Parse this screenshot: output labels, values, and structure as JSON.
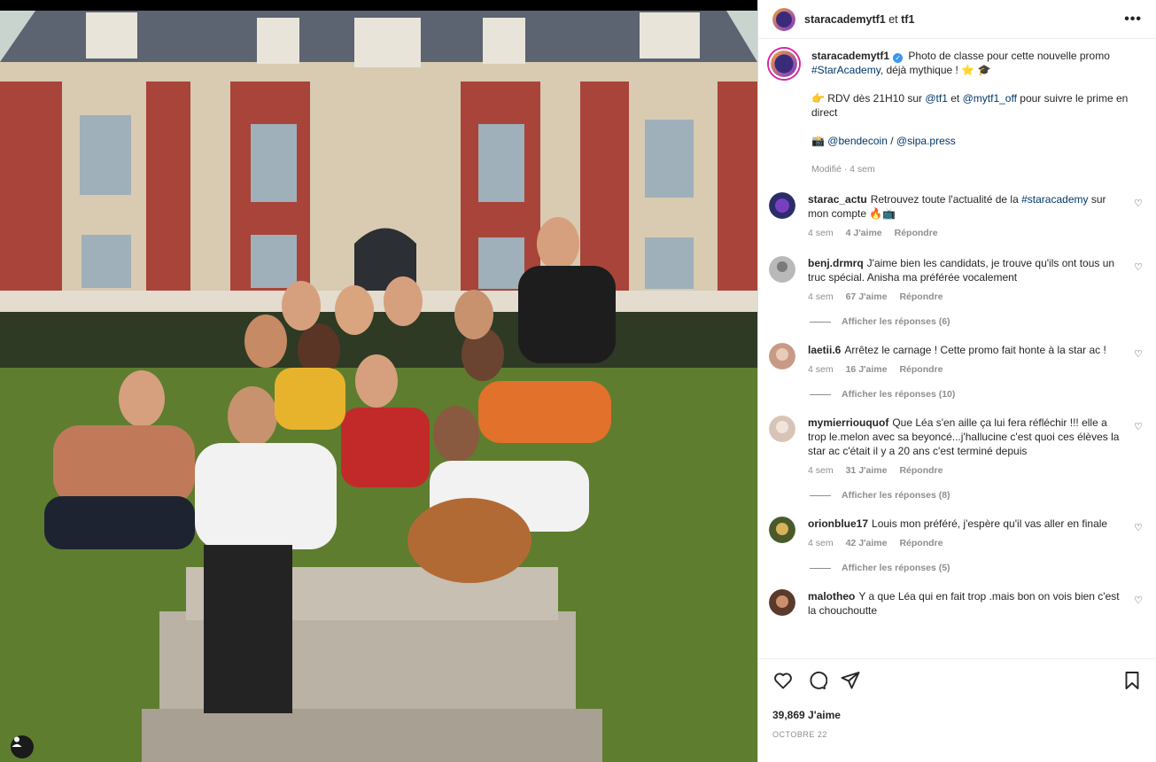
{
  "post": {
    "author": "staracademytf1",
    "coauthor_sep": "et",
    "coauthor": "tf1",
    "more_icon": "more-horizontal-icon"
  },
  "caption": {
    "username": "staracademytf1",
    "text_1a": "Photo de classe pour cette nouvelle promo",
    "hashtag": "#StarAcademy",
    "text_1b": ", déjà mythique ! ⭐ 🎓",
    "rdv_emoji": "👉",
    "rdv_a": "RDV dès 21H10 sur",
    "mention_tf1": "@tf1",
    "rdv_et": "et",
    "mention_mytf1": "@mytf1_off",
    "rdv_b": "pour suivre le prime en direct",
    "credit_emoji": "📸",
    "credit_1": "@bendecoin",
    "credit_sep": "/",
    "credit_2": "@sipa.press",
    "edited": "Modifié · 4 sem"
  },
  "comments": [
    {
      "username": "starac_actu",
      "text_a": "Retrouvez toute l'actualité de la",
      "hashtag": "#staracademy",
      "text_b": "sur mon compte 🔥📺",
      "age": "4 sem",
      "likes": "4 J'aime",
      "reply": "Répondre",
      "avatar_color": "#2b2d6b"
    },
    {
      "username": "benj.drmrq",
      "text": "J'aime bien les candidats, je trouve qu'ils ont tous un truc spécial. Anisha ma préférée vocalement",
      "age": "4 sem",
      "likes": "67 J'aime",
      "reply": "Répondre",
      "replies": "Afficher les réponses (6)",
      "avatar_color": "#b9b9b9"
    },
    {
      "username": "laetii.6",
      "text": "Arrêtez le carnage ! Cette promo fait honte à la star ac !",
      "age": "4 sem",
      "likes": "16 J'aime",
      "reply": "Répondre",
      "replies": "Afficher les réponses (10)",
      "avatar_color": "#c89a86"
    },
    {
      "username": "mymierriouquof",
      "text": "Que Léa s'en aille ça lui fera réfléchir !!! elle a trop le.melon avec sa beyoncé...j'hallucine c'est quoi ces élèves la star ac c'était il y a 20 ans c'est terminé depuis",
      "age": "4 sem",
      "likes": "31 J'aime",
      "reply": "Répondre",
      "replies": "Afficher les réponses (8)",
      "avatar_color": "#d8c4b6"
    },
    {
      "username": "orionblue17",
      "text": "Louis mon préféré, j'espère qu'il vas aller en finale",
      "age": "4 sem",
      "likes": "42 J'aime",
      "reply": "Répondre",
      "replies": "Afficher les réponses (5)",
      "avatar_color": "#4a5a2a"
    },
    {
      "username": "malotheo",
      "text": "Y a que Léa qui en fait trop .mais bon on vois bien c'est la chouchoutte",
      "avatar_color": "#5a3a2a"
    }
  ],
  "actions": {
    "like_icon": "heart-icon",
    "comment_icon": "comment-icon",
    "share_icon": "send-icon",
    "save_icon": "bookmark-icon",
    "likes": "39,869 J'aime",
    "date": "OCTOBRE 22"
  },
  "colors": {
    "accent_link": "#00376b",
    "muted": "#8e8e8e",
    "border": "#dbdbdb",
    "verified": "#3897f0"
  }
}
